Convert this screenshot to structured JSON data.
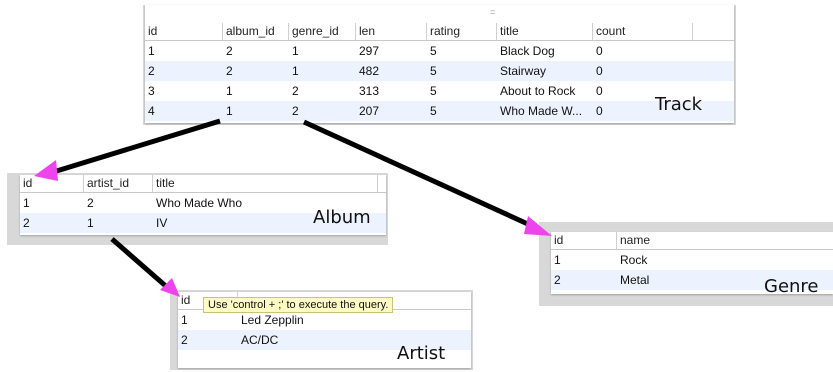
{
  "track": {
    "caption": "Track",
    "handle": "=",
    "columns": [
      "id",
      "album_id",
      "genre_id",
      "len",
      "rating",
      "title",
      "count"
    ],
    "rows": [
      [
        "1",
        "2",
        "1",
        "297",
        "5",
        "Black Dog",
        "0"
      ],
      [
        "2",
        "2",
        "1",
        "482",
        "5",
        "Stairway",
        "0"
      ],
      [
        "3",
        "1",
        "2",
        "313",
        "5",
        "About to Rock",
        "0"
      ],
      [
        "4",
        "1",
        "2",
        "207",
        "5",
        "Who Made W...",
        "0"
      ]
    ]
  },
  "album": {
    "caption": "Album",
    "columns": [
      "id",
      "artist_id",
      "title"
    ],
    "rows": [
      [
        "1",
        "2",
        "Who Made Who"
      ],
      [
        "2",
        "1",
        "IV"
      ]
    ]
  },
  "genre": {
    "caption": "Genre",
    "columns": [
      "id",
      "name"
    ],
    "rows": [
      [
        "1",
        "Rock"
      ],
      [
        "2",
        "Metal"
      ]
    ]
  },
  "artist": {
    "caption": "Artist",
    "columns": [
      "id"
    ],
    "rows": [
      [
        "1",
        "Led Zepplin"
      ],
      [
        "2",
        "AC/DC"
      ]
    ],
    "tooltip": "Use 'control + ;' to execute the query."
  },
  "colors": {
    "arrow": "#000000",
    "arrowhead": "#ee44ee",
    "row_alt": "#edf3fe",
    "tooltip_bg": "#fdfbc3"
  }
}
